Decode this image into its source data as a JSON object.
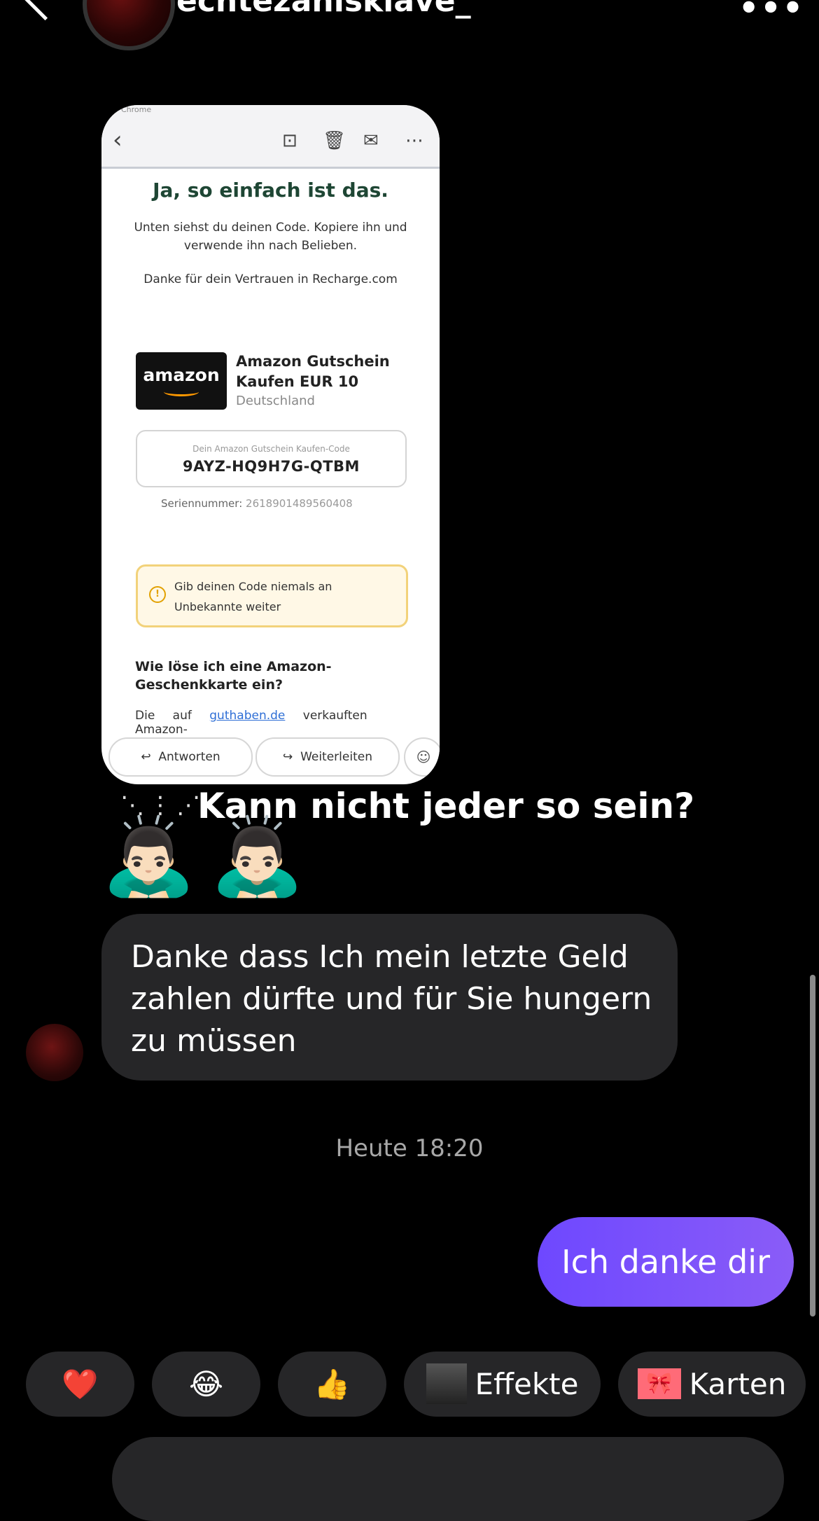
{
  "header": {
    "username": "echtezahlsklave_",
    "back_icon": "back-chevron-icon",
    "more_icon": "more-dots-icon",
    "more_glyph": "•••"
  },
  "shared_screenshot": {
    "app_label": "Chrome",
    "toolbar_icons": [
      "back-icon",
      "archive-icon",
      "trash-icon",
      "mark-mail-icon",
      "more-icon"
    ],
    "title": "Ja, so einfach ist das.",
    "subtitle": "Unten siehst du deinen Code. Kopiere ihn und verwende ihn nach Belieben.",
    "thanks": "Danke für dein Vertrauen in Recharge.com",
    "logo_text": "amazon",
    "product_name": "Amazon Gutschein Kaufen EUR 10",
    "product_country": "Deutschland",
    "code_label": "Dein Amazon Gutschein Kaufen-Code",
    "code_value": "9AYZ-HQ9H7G-QTBM",
    "serial_label": "Seriennummer:",
    "serial_value": "2618901489560408",
    "warning": "Gib deinen Code niemals an Unbekannte weiter",
    "faq_title": "Wie löse ich eine Amazon-Geschenkkarte ein?",
    "faq_text_1": "Die auf",
    "faq_link": "guthaben.de",
    "faq_text_2": "verkauften Amazon-",
    "reply_button": "Antworten",
    "forward_button": "Weiterleiten"
  },
  "caption": "Kann nicht jeder so sein?",
  "bow_emoji": "🙇🏻‍♂️",
  "incoming_message": "Danke dass Ich mein letzte Geld zahlen dürfte und für Sie hungern zu müssen",
  "timestamp": "Heute 18:20",
  "outgoing_message": "Ich danke dir",
  "reactions": {
    "heart": "❤️",
    "laugh": "😂",
    "thumbs": "👍",
    "effects_label": "Effekte",
    "cards_label": "Karten",
    "cards_glyph": "🎀"
  }
}
